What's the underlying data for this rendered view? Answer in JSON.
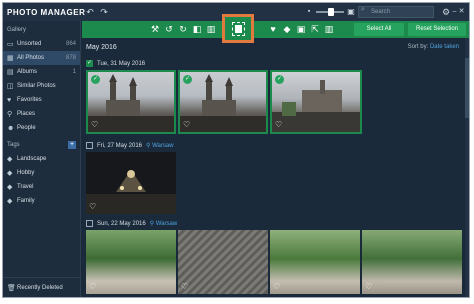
{
  "app": {
    "title": "PHOTO MANAGER"
  },
  "search": {
    "placeholder": "Search"
  },
  "sidebar": {
    "gallery_label": "Gallery",
    "items": [
      {
        "label": "Unsorted",
        "count": "864"
      },
      {
        "label": "All Photos",
        "count": "878"
      },
      {
        "label": "Albums",
        "count": "1"
      },
      {
        "label": "Similar Photos",
        "count": ""
      },
      {
        "label": "Favorites",
        "count": ""
      },
      {
        "label": "Places",
        "count": ""
      },
      {
        "label": "People",
        "count": ""
      }
    ],
    "tags_label": "Tags",
    "tags": [
      {
        "label": "Landscape"
      },
      {
        "label": "Hobby"
      },
      {
        "label": "Travel"
      },
      {
        "label": "Family"
      }
    ],
    "recent_deleted": "Recently Deleted"
  },
  "actionbar": {
    "select_all": "Select All",
    "reset_selection": "Reset Selection"
  },
  "content": {
    "month": "May 2016",
    "sort_by_label": "Sort by:",
    "sort_by_value": "Date taken",
    "groups": [
      {
        "date": "Tue, 31 May 2016",
        "location": ""
      },
      {
        "date": "Fri, 27 May 2016",
        "location": "Warsaw"
      },
      {
        "date": "Sun, 22 May 2016",
        "location": "Warsaw"
      }
    ]
  },
  "colors": {
    "accent_green": "#1d8a4d",
    "highlight_orange": "#e27a3f",
    "link_blue": "#4ea3e0"
  }
}
